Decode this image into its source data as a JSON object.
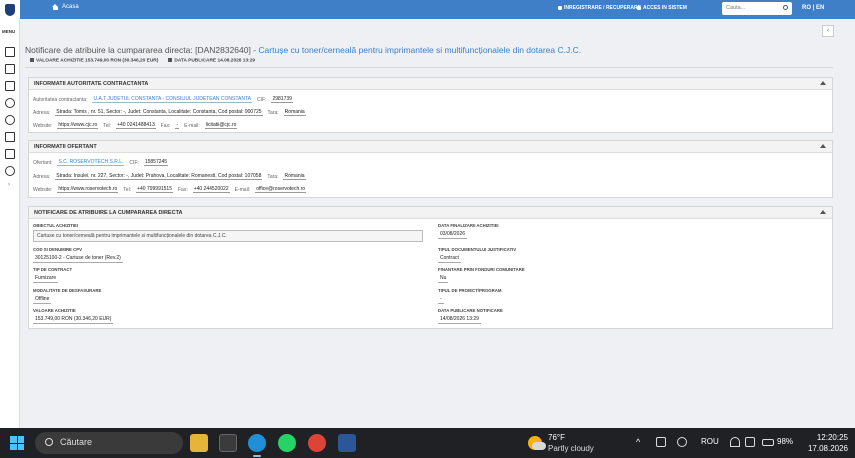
{
  "nav": {
    "home_label": "Acasa",
    "register_label": "INREGISTRARE / RECUPERARE",
    "access_label": "ACCES IN SISTEM",
    "search_placeholder": "Cauta...",
    "lang_label": "RO | EN",
    "brand_color": "#3f7fc7"
  },
  "rail": {
    "menu_label": "MENU",
    "icons": [
      "document-icon",
      "list-icon",
      "calendar-icon",
      "help-icon",
      "tools-icon",
      "id-card-icon",
      "table-icon",
      "chat-icon"
    ],
    "expand_label": "›"
  },
  "header": {
    "collapse_label": "‹",
    "title_prefix": "Notificare de atribuire la cumpararea directa: [DAN2832640] - ",
    "title_link": "Cartușe cu toner/cerneală pentru imprimantele si multifuncționalele din dotarea C.J.C.",
    "value_label": "VALOARE ACHIZITIE 153.749,00 RON (30.346,20 EUR)",
    "date_label": "DATA PUBLICARE 14.08.2026 13:29"
  },
  "authority": {
    "heading": "INFORMATII AUTORITATE CONTRACTANTA",
    "name_label": "Autoritatea contractanta:",
    "name_value": "U.A.T JUDETUL CONSTANTA - CONSILIUL JUDETEAN CONSTANTA",
    "cif_label": "CIF:",
    "cif_value": "2981739",
    "address_label": "Adresa:",
    "address_value": "Strada: Tomis , nr. 51, Sector: -, Judet: Constanta, Localitate: Constanta, Cod postal: 900725",
    "country_label": "Tara:",
    "country_value": "Romania",
    "website_label": "Website:",
    "website_value": "https://www.cjc.ro",
    "tel_label": "Tel:",
    "tel_value": "+40 0241488413",
    "fax_label": "Fax:",
    "fax_value": "-",
    "email_label": "E-mail:",
    "email_value": "licitatii@cjc.ro"
  },
  "bidder": {
    "heading": "INFORMATII OFERTANT",
    "name_label": "Ofertant:",
    "name_value": "S.C. ROSERVOTECH S.R.L.",
    "cif_label": "CIF:",
    "cif_value": "15857245",
    "address_label": "Adresa:",
    "address_value": "Strada: Insulei, nr. 227, Sector: -, Judet: Prahova, Localitate: Romanesti, Cod postal: 107058",
    "country_label": "Tara:",
    "country_value": "Romania",
    "website_label": "Website:",
    "website_value": "https://www.roservotech.ro",
    "tel_label": "Tel:",
    "tel_value": "+40 799991515",
    "fax_label": "Fax:",
    "fax_value": "+40 244520022",
    "email_label": "E-mail:",
    "email_value": "office@roservotech.ro"
  },
  "notice": {
    "heading": "NOTIFICARE DE ATRIBUIRE LA CUMPARAREA DIRECTA",
    "object_label": "OBIECTUL ACHIZITIEI",
    "object_value": "Cartuse cu toner/cerneală pentru imprimantele si multifuncționalele din dotarea C.J.C.",
    "cpv_label": "COD SI DENUMIRE CPV",
    "cpv_value": "30125100-2 - Cartuse de toner (Rev.2)",
    "contract_type_label": "TIP DE CONTRACT",
    "contract_type_value": "Furnizare",
    "mode_label": "MODALITATE DE DESFASURARE",
    "mode_value": "Offline",
    "value_label": "VALOARE ACHIZITIE",
    "value_value": "153.749,00 RON (30.346,20 EUR)",
    "finalize_label": "DATA FINALIZARII ACHIZITIEI",
    "finalize_value": "03/08/2026",
    "doc_type_label": "TIPUL DOCUMENTULUI JUSTIFICATIV",
    "doc_type_value": "Contract",
    "eu_funds_label": "FINANTARE PRIN FONDURI COMUNITARE",
    "eu_funds_value": "Nu",
    "project_label": "TIPUL DE PROIECT/PROGRAM",
    "project_value": "-",
    "pub_label": "DATA PUBLICARE NOTIFICARE",
    "pub_value": "14/08/2026 13:29"
  },
  "taskbar": {
    "search_label": "Căutare",
    "temp": "76°F",
    "weather": "Partly cloudy",
    "lang": "ROU",
    "battery": "98%",
    "time": "12:20:25",
    "date": "17.08.2026"
  }
}
